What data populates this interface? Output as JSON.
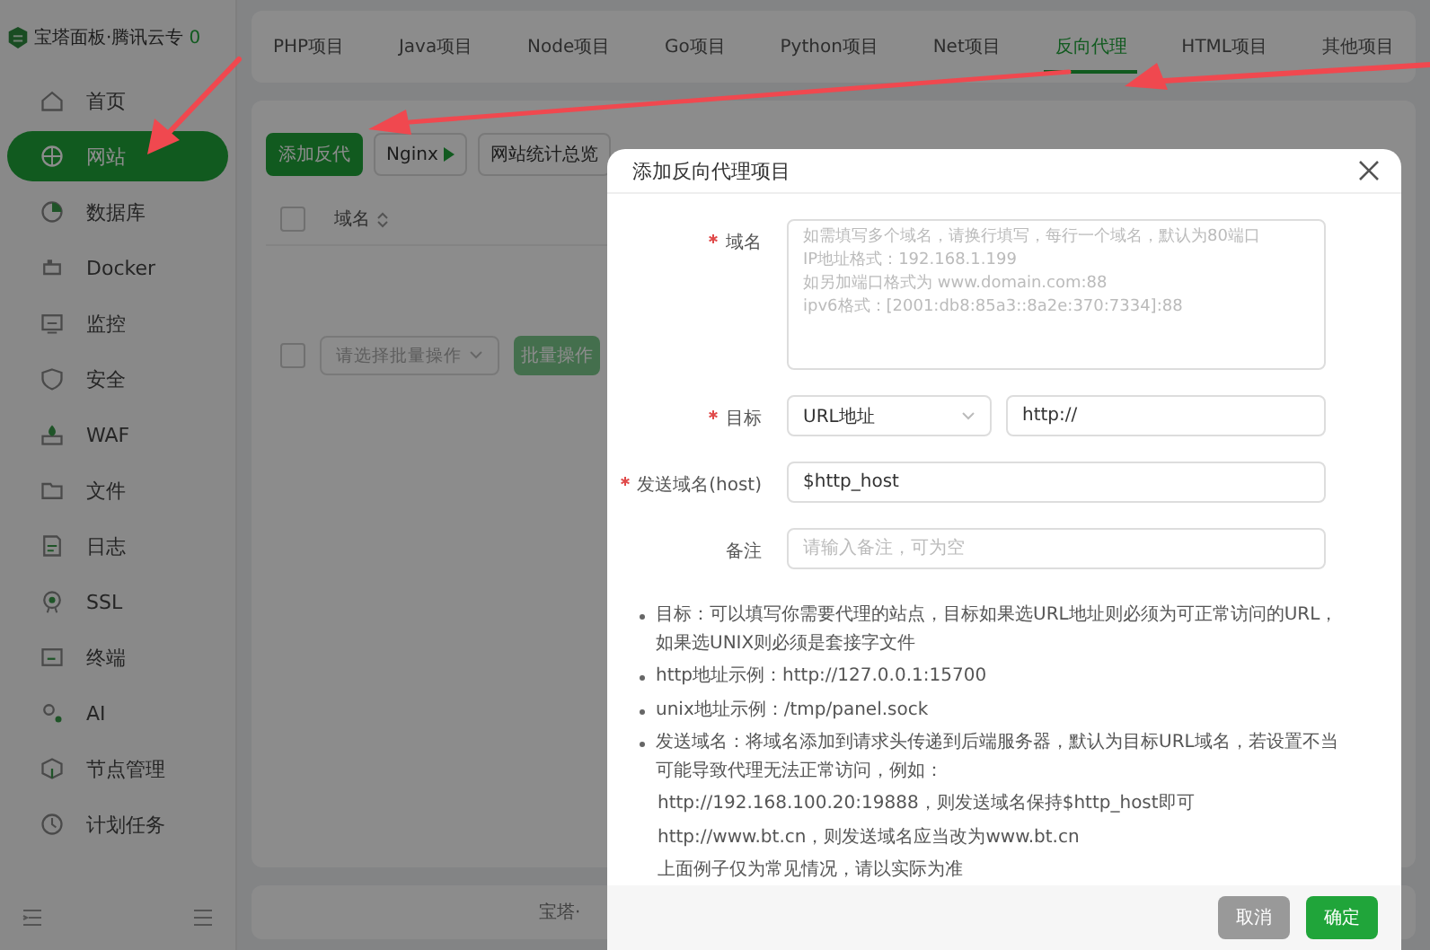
{
  "sidebar": {
    "title": "宝塔面板·腾讯云专",
    "badge": "0",
    "items": [
      {
        "label": "首页",
        "selected": false
      },
      {
        "label": "网站",
        "selected": true
      },
      {
        "label": "数据库",
        "selected": false
      },
      {
        "label": "Docker",
        "selected": false
      },
      {
        "label": "监控",
        "selected": false
      },
      {
        "label": "安全",
        "selected": false
      },
      {
        "label": "WAF",
        "selected": false
      },
      {
        "label": "文件",
        "selected": false
      },
      {
        "label": "日志",
        "selected": false
      },
      {
        "label": "SSL",
        "selected": false
      },
      {
        "label": "终端",
        "selected": false
      },
      {
        "label": "AI",
        "selected": false
      },
      {
        "label": "节点管理",
        "selected": false
      },
      {
        "label": "计划任务",
        "selected": false
      }
    ]
  },
  "tabs": [
    {
      "label": "PHP项目",
      "selected": false
    },
    {
      "label": "Java项目",
      "selected": false
    },
    {
      "label": "Node项目",
      "selected": false
    },
    {
      "label": "Go项目",
      "selected": false
    },
    {
      "label": "Python项目",
      "selected": false
    },
    {
      "label": "Net项目",
      "selected": false
    },
    {
      "label": "反向代理",
      "selected": true
    },
    {
      "label": "HTML项目",
      "selected": false
    },
    {
      "label": "其他项目",
      "selected": false
    }
  ],
  "toolbar": [
    {
      "label": "添加反代",
      "kind": "primary"
    },
    {
      "label": "Nginx",
      "kind": "default"
    },
    {
      "label": "网站统计总览",
      "kind": "default"
    }
  ],
  "table": {
    "header_checkbox": {
      "checked": false
    },
    "columns": [
      "域名"
    ],
    "batch_checkbox": {
      "checked": false
    },
    "batch_select": {
      "placeholder": "请选择批量操作"
    },
    "batch_button": "批量操作"
  },
  "footer": "宝塔·",
  "dialog": {
    "title": "添加反向代理项目",
    "fields": [
      {
        "label": "域名",
        "required": true,
        "kind": "textarea",
        "placeholder": "如需填写多个域名，请换行填写，每行一个域名，默认为80端口\nIP地址格式：192.168.1.199\n如另加端口格式为 www.domain.com:88\nipv6格式：[2001:db8:85a3::8a2e:370:7334]:88"
      },
      {
        "label": "目标",
        "required": true,
        "kind": "target",
        "select": "URL地址",
        "value": "http://"
      },
      {
        "label": "发送域名(host)",
        "required": true,
        "kind": "input",
        "value": "$http_host"
      },
      {
        "label": "备注",
        "required": false,
        "kind": "input",
        "placeholder": "请输入备注，可为空"
      }
    ],
    "notes": [
      {
        "kind": "bullet",
        "text": "目标：可以填写你需要代理的站点，目标如果选URL地址则必须为可正常访问的URL，如果选UNIX则必须是套接字文件"
      },
      {
        "kind": "bullet",
        "text": "http地址示例：http://127.0.0.1:15700"
      },
      {
        "kind": "bullet",
        "text": "unix地址示例：/tmp/panel.sock"
      },
      {
        "kind": "bullet",
        "text": "发送域名：将域名添加到请求头传递到后端服务器，默认为目标URL域名，若设置不当可能导致代理无法正常访问，例如："
      },
      {
        "kind": "plain",
        "text": "http://192.168.100.20:19888，则发送域名保持$http_host即可"
      },
      {
        "kind": "plain",
        "text": "http://www.bt.cn，则发送域名应当改为www.bt.cn"
      },
      {
        "kind": "plain",
        "text": "上面例子仅为常见情况，请以实际为准"
      }
    ],
    "buttons": [
      {
        "label": "取消",
        "kind": "cancel"
      },
      {
        "label": "确定",
        "kind": "confirm"
      }
    ]
  }
}
